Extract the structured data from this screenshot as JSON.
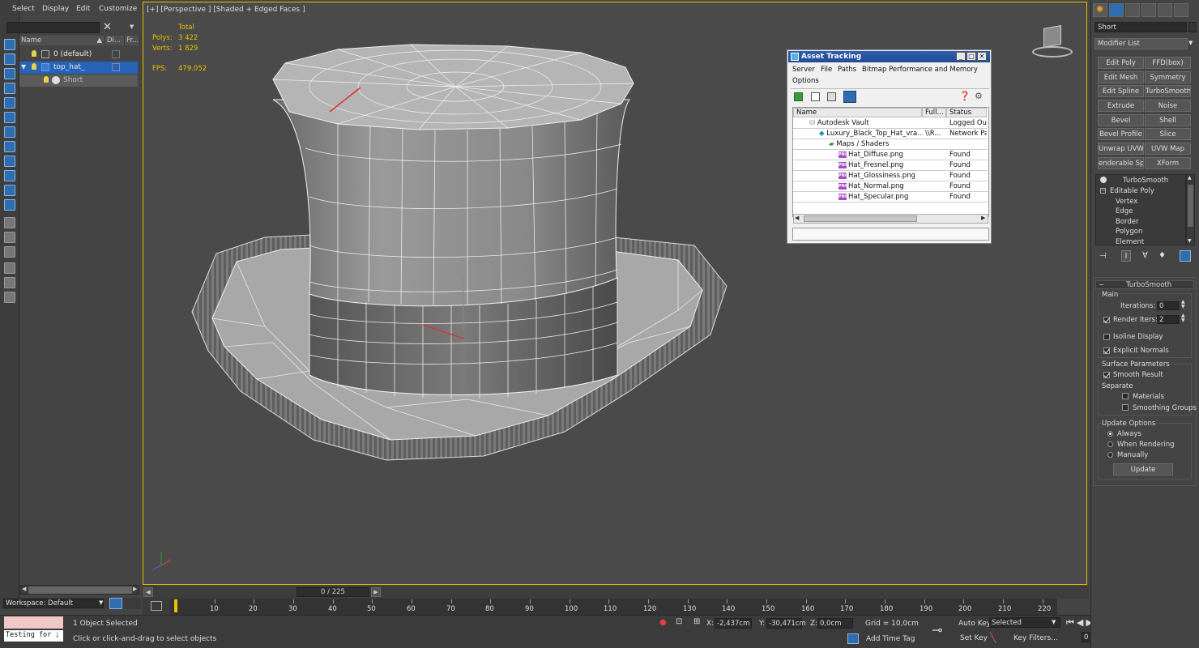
{
  "scene_explorer": {
    "menu": [
      "Select",
      "Display",
      "Edit",
      "Customize"
    ],
    "columns": [
      "Name",
      "Di...",
      "Fr..."
    ],
    "rows": [
      "0 (default)",
      "top_hat_",
      "Short"
    ],
    "workspace": "Workspace: Default"
  },
  "viewport": {
    "label": "[+] [Perspective ] [Shaded + Edged Faces ]",
    "stats": {
      "total_label": "Total",
      "polys_label": "Polys:",
      "polys_value": "3 422",
      "verts_label": "Verts:",
      "verts_value": "1 829",
      "fps_label": "FPS:",
      "fps_value": "479.052"
    }
  },
  "timeline": {
    "slider": "0 / 225",
    "ticks": [
      "10",
      "20",
      "30",
      "40",
      "50",
      "60",
      "70",
      "80",
      "90",
      "100",
      "110",
      "120",
      "130",
      "140",
      "150",
      "160",
      "170",
      "180",
      "190",
      "200",
      "210",
      "220"
    ]
  },
  "status": {
    "maxscript": "Testing for ;",
    "selected": "1 Object Selected",
    "prompt": "Click or click-and-drag to select objects",
    "x_label": "X:",
    "x_value": "-2,437cm",
    "y_label": "Y:",
    "y_value": "-30,471cm",
    "z_label": "Z:",
    "z_value": "0,0cm",
    "grid": "Grid = 10,0cm",
    "auto_key": "Auto Key",
    "set_key": "Set Key",
    "selected_dropdown": "Selected",
    "key_filters": "Key Filters...",
    "add_time_tag": "Add Time Tag",
    "frame": "0"
  },
  "command_panel": {
    "object_name": "Short",
    "modifier_list": "Modifier List",
    "modifier_buttons": [
      "Edit Poly",
      "FFD(box)",
      "Edit Mesh",
      "Symmetry",
      "Edit Spline",
      "TurboSmooth",
      "Extrude",
      "Noise",
      "Bevel",
      "Shell",
      "Bevel Profile",
      "Slice",
      "Unwrap UVW",
      "UVW Map",
      "enderable Splin",
      "XForm"
    ],
    "stack": [
      "TurboSmooth",
      "Editable Poly",
      "Vertex",
      "Edge",
      "Border",
      "Polygon",
      "Element"
    ],
    "turbosmooth": {
      "title": "TurboSmooth",
      "main": "Main",
      "iterations_label": "Iterations:",
      "iterations_value": "0",
      "render_iters_label": "Render Iters:",
      "render_iters_value": "2",
      "isoline": "Isoline Display",
      "explicit_normals": "Explicit Normals",
      "surface_params": "Surface Parameters",
      "smooth_result": "Smooth Result",
      "separate": "Separate",
      "materials": "Materials",
      "smoothing_groups": "Smoothing Groups",
      "update_options": "Update Options",
      "always": "Always",
      "when_rendering": "When Rendering",
      "manually": "Manually",
      "update_button": "Update"
    }
  },
  "asset_tracking": {
    "title": "Asset Tracking",
    "menu": [
      "Server",
      "File",
      "Paths",
      "Bitmap Performance and Memory",
      "Options"
    ],
    "columns": [
      "Name",
      "Full...",
      "Status"
    ],
    "rows": [
      {
        "name": "Autodesk Vault",
        "full": "",
        "status": "Logged Out"
      },
      {
        "name": "Luxury_Black_Top_Hat_vra...",
        "full": "\\\\R...",
        "status": "Network Path"
      },
      {
        "name": "Maps / Shaders",
        "full": "",
        "status": ""
      },
      {
        "name": "Hat_Diffuse.png",
        "full": "",
        "status": "Found"
      },
      {
        "name": "Hat_Fresnel.png",
        "full": "",
        "status": "Found"
      },
      {
        "name": "Hat_Glossiness.png",
        "full": "",
        "status": "Found"
      },
      {
        "name": "Hat_Normal.png",
        "full": "",
        "status": "Found"
      },
      {
        "name": "Hat_Specular.png",
        "full": "",
        "status": "Found"
      }
    ]
  }
}
